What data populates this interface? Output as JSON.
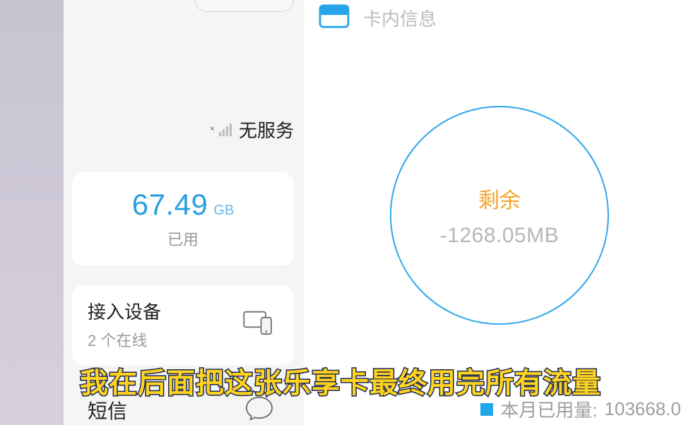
{
  "left": {
    "no_service_label": "无服务",
    "usage": {
      "value": "67.49",
      "unit": "GB",
      "label": "已用"
    },
    "device": {
      "title": "接入设备",
      "sub": "2 个在线"
    },
    "sms_label": "短信"
  },
  "right": {
    "card_info_label": "卡内信息",
    "ring": {
      "label": "剩余",
      "value": "-1268.05MB"
    },
    "month_usage": {
      "label": "本月已用量:",
      "value": "103668.0"
    }
  },
  "caption": "我在后面把这张乐享卡最终用完所有流量"
}
